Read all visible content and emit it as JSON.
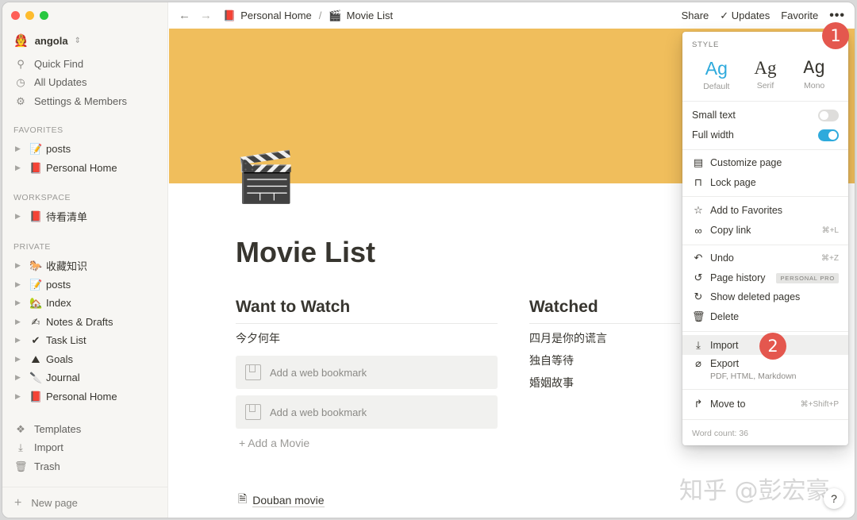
{
  "sidebar": {
    "workspace": {
      "emoji": "🧑‍🚒",
      "name": "angola"
    },
    "utilities": [
      {
        "icon": "search-icon",
        "glyph": "⚲",
        "label": "Quick Find"
      },
      {
        "icon": "clock-icon",
        "glyph": "◷",
        "label": "All Updates"
      },
      {
        "icon": "gear-icon",
        "glyph": "⚙",
        "label": "Settings & Members"
      }
    ],
    "favorites_label": "FAVORITES",
    "favorites": [
      {
        "emoji": "📝",
        "label": "posts"
      },
      {
        "emoji": "📕",
        "label": "Personal Home"
      }
    ],
    "workspace_label": "WORKSPACE",
    "workspace_pages": [
      {
        "emoji": "📕",
        "label": "待看清单"
      }
    ],
    "private_label": "PRIVATE",
    "private_pages": [
      {
        "emoji": "🐎",
        "label": "收藏知识"
      },
      {
        "emoji": "📝",
        "label": "posts"
      },
      {
        "emoji": "🏡",
        "label": "Index"
      },
      {
        "emoji": "✍",
        "label": "Notes & Drafts"
      },
      {
        "emoji": "✔",
        "label": "Task List"
      },
      {
        "emoji": "⛰",
        "label": "Goals"
      },
      {
        "emoji": "🔪",
        "label": "Journal"
      },
      {
        "emoji": "📕",
        "label": "Personal Home"
      }
    ],
    "bottom": [
      {
        "icon": "templates-icon",
        "glyph": "❖",
        "label": "Templates"
      },
      {
        "icon": "import-icon",
        "glyph": "⤓",
        "label": "Import"
      },
      {
        "icon": "trash-icon",
        "glyph": "🗑",
        "label": "Trash"
      }
    ],
    "new_page": "New page"
  },
  "topbar": {
    "breadcrumb": [
      {
        "emoji": "📕",
        "label": "Personal Home"
      },
      {
        "emoji": "🎬",
        "label": "Movie List"
      }
    ],
    "share": "Share",
    "updates": "Updates",
    "favorite": "Favorite"
  },
  "page": {
    "icon": "🎬",
    "title": "Movie List",
    "want": {
      "heading": "Want to Watch",
      "items": [
        "今夕何年"
      ],
      "bookmark_placeholder": "Add a web bookmark",
      "add_label": "Add a Movie"
    },
    "watched": {
      "heading": "Watched",
      "items": [
        "四月是你的谎言",
        "独自等待",
        "婚姻故事"
      ]
    },
    "douban": "Douban movie"
  },
  "menu": {
    "style_label": "STYLE",
    "fonts": [
      {
        "ag": "Ag",
        "name": "Default",
        "active": true
      },
      {
        "ag": "Ag",
        "name": "Serif",
        "active": false
      },
      {
        "ag": "Ag",
        "name": "Mono",
        "active": false
      }
    ],
    "small_text": {
      "label": "Small text",
      "on": false
    },
    "full_width": {
      "label": "Full width",
      "on": true
    },
    "customize": "Customize page",
    "lock": "Lock page",
    "add_fav": "Add to Favorites",
    "copy_link": "Copy link",
    "copy_link_sc": "⌘+L",
    "undo": "Undo",
    "undo_sc": "⌘+Z",
    "history": "Page history",
    "history_badge": "PERSONAL PRO",
    "show_deleted": "Show deleted pages",
    "delete": "Delete",
    "import": "Import",
    "export": "Export",
    "export_sub": "PDF, HTML, Markdown",
    "move_to": "Move to",
    "move_sc": "⌘+Shift+P",
    "word_count": "Word count: 36"
  },
  "annotations": {
    "step1": "1",
    "step2": "2"
  },
  "watermark": "知乎 @彭宏豪",
  "help": "?",
  "colors": {
    "cover": "#f0be5c",
    "accent": "#2eaadc",
    "step": "#e4574e"
  }
}
